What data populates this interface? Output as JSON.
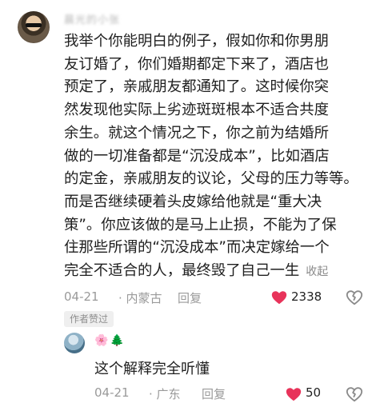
{
  "comment": {
    "username": "晨光的小张",
    "lines": [
      "我举个你能明白的例子，假如你和你男朋",
      "友订婚了，你们婚期都定下来了，酒店也",
      "预定了，亲戚朋友都通知了。这时候你突",
      "然发现他实际上劣迹斑斑根本不适合共度",
      "余生。就这个情况之下，你之前为结婚所",
      "做的一切准备都是“沉没成本”，比如酒店",
      "的定金，亲戚朋友的议论，父母的压力等等。",
      "而是否继续硬着头皮嫁给他就是“重大决",
      "策”。你应该做的是马上止损，不能为了保",
      "住那些所谓的“沉没成本”而决定嫁给一个",
      "完全不适合的人，最终毁了自己一生"
    ],
    "collapse_label": "收起",
    "date": "04-21",
    "location": "· 内蒙古",
    "reply_label": "回复",
    "like_count": "2338",
    "author_badge": "作者赞过",
    "colors": {
      "accent": "#e8335a",
      "muted": "#9a9a9a"
    }
  },
  "reply": {
    "name_icons": [
      "🌸",
      "🌲"
    ],
    "text": "这个解释完全听懂",
    "date": "04-21",
    "location": "· 广东",
    "reply_label": "回复",
    "like_count": "50"
  }
}
